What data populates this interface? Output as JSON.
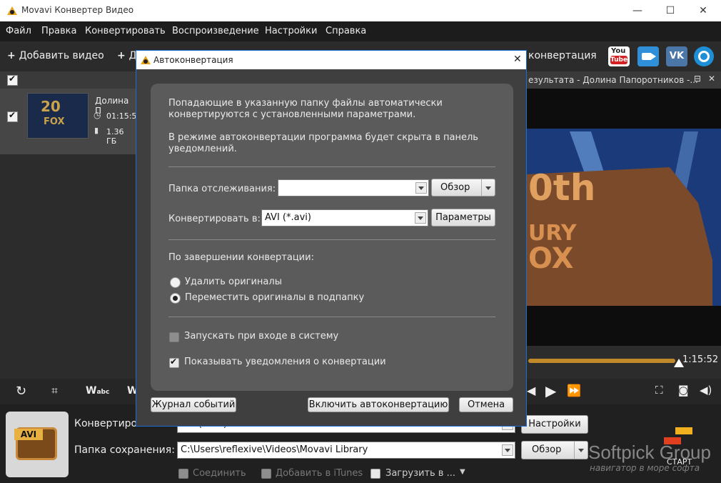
{
  "window": {
    "title": "Movavi Конвертер Видео",
    "minimize": "—",
    "maximize": "☐",
    "close": "✕"
  },
  "menu": [
    "Файл",
    "Правка",
    "Конвертировать",
    "Воспроизведение",
    "Настройки",
    "Справка"
  ],
  "toolbar": {
    "add_video": "Добавить видео",
    "add_second": "Д",
    "autoconvert": "конвертация"
  },
  "social": {
    "youtube_top": "You",
    "youtube_bottom": "Tube",
    "vk": "VK"
  },
  "file": {
    "name": "Долина П",
    "duration": "01:15:5",
    "size": "1.36 ГБ",
    "thumb_line1": "20",
    "thumb_line2": "FOX"
  },
  "preview": {
    "header": "езультата - Долина Папоротников -...",
    "time": "1:15:52",
    "progress": 0.95,
    "logo_text": "0th",
    "logo_sub": "URY",
    "logo_sub2": "OX"
  },
  "controls": {
    "watermark_label": "W",
    "watermark_sub": "abc",
    "w2": "W"
  },
  "bottom": {
    "format_badge": "AVI",
    "convert_label": "Конвертировать в:",
    "convert_value": "AVI (*.avi)",
    "settings_button": "Настройки",
    "save_label": "Папка сохранения:",
    "save_path": "C:\\Users\\reflexive\\Videos\\Movavi Library",
    "browse_button": "Обзор",
    "merge": "Соединить",
    "itunes": "Добавить в iTunes",
    "upload": "Загрузить в ...",
    "start": "СТАРТ"
  },
  "watermark": {
    "brand": "Softpick Group",
    "tagline": "навигатор в море софта"
  },
  "dialog": {
    "title": "Автоконвертация",
    "close": "✕",
    "intro1": "Попадающие в указанную папку файлы автоматически",
    "intro2": "конвертируются с установленными параметрами.",
    "intro3": "В режиме автоконвертации программа будет скрыта в панель",
    "intro4": "уведомлений.",
    "watch_label": "Папка отслеживания:",
    "watch_value": "",
    "browse_button": "Обзор",
    "convert_label": "Конвертировать в:",
    "convert_value": "AVI (*.avi)",
    "params_button": "Параметры",
    "after_label": "По завершении конвертации:",
    "opt_delete": "Удалить оригиналы",
    "opt_move": "Переместить оригиналы в подпапку",
    "startup": "Запускать при входе в систему",
    "notify": "Показывать уведомления о конвертации",
    "log_button": "Журнал событий",
    "enable_button": "Включить автоконвертацию",
    "cancel_button": "Отмена"
  }
}
